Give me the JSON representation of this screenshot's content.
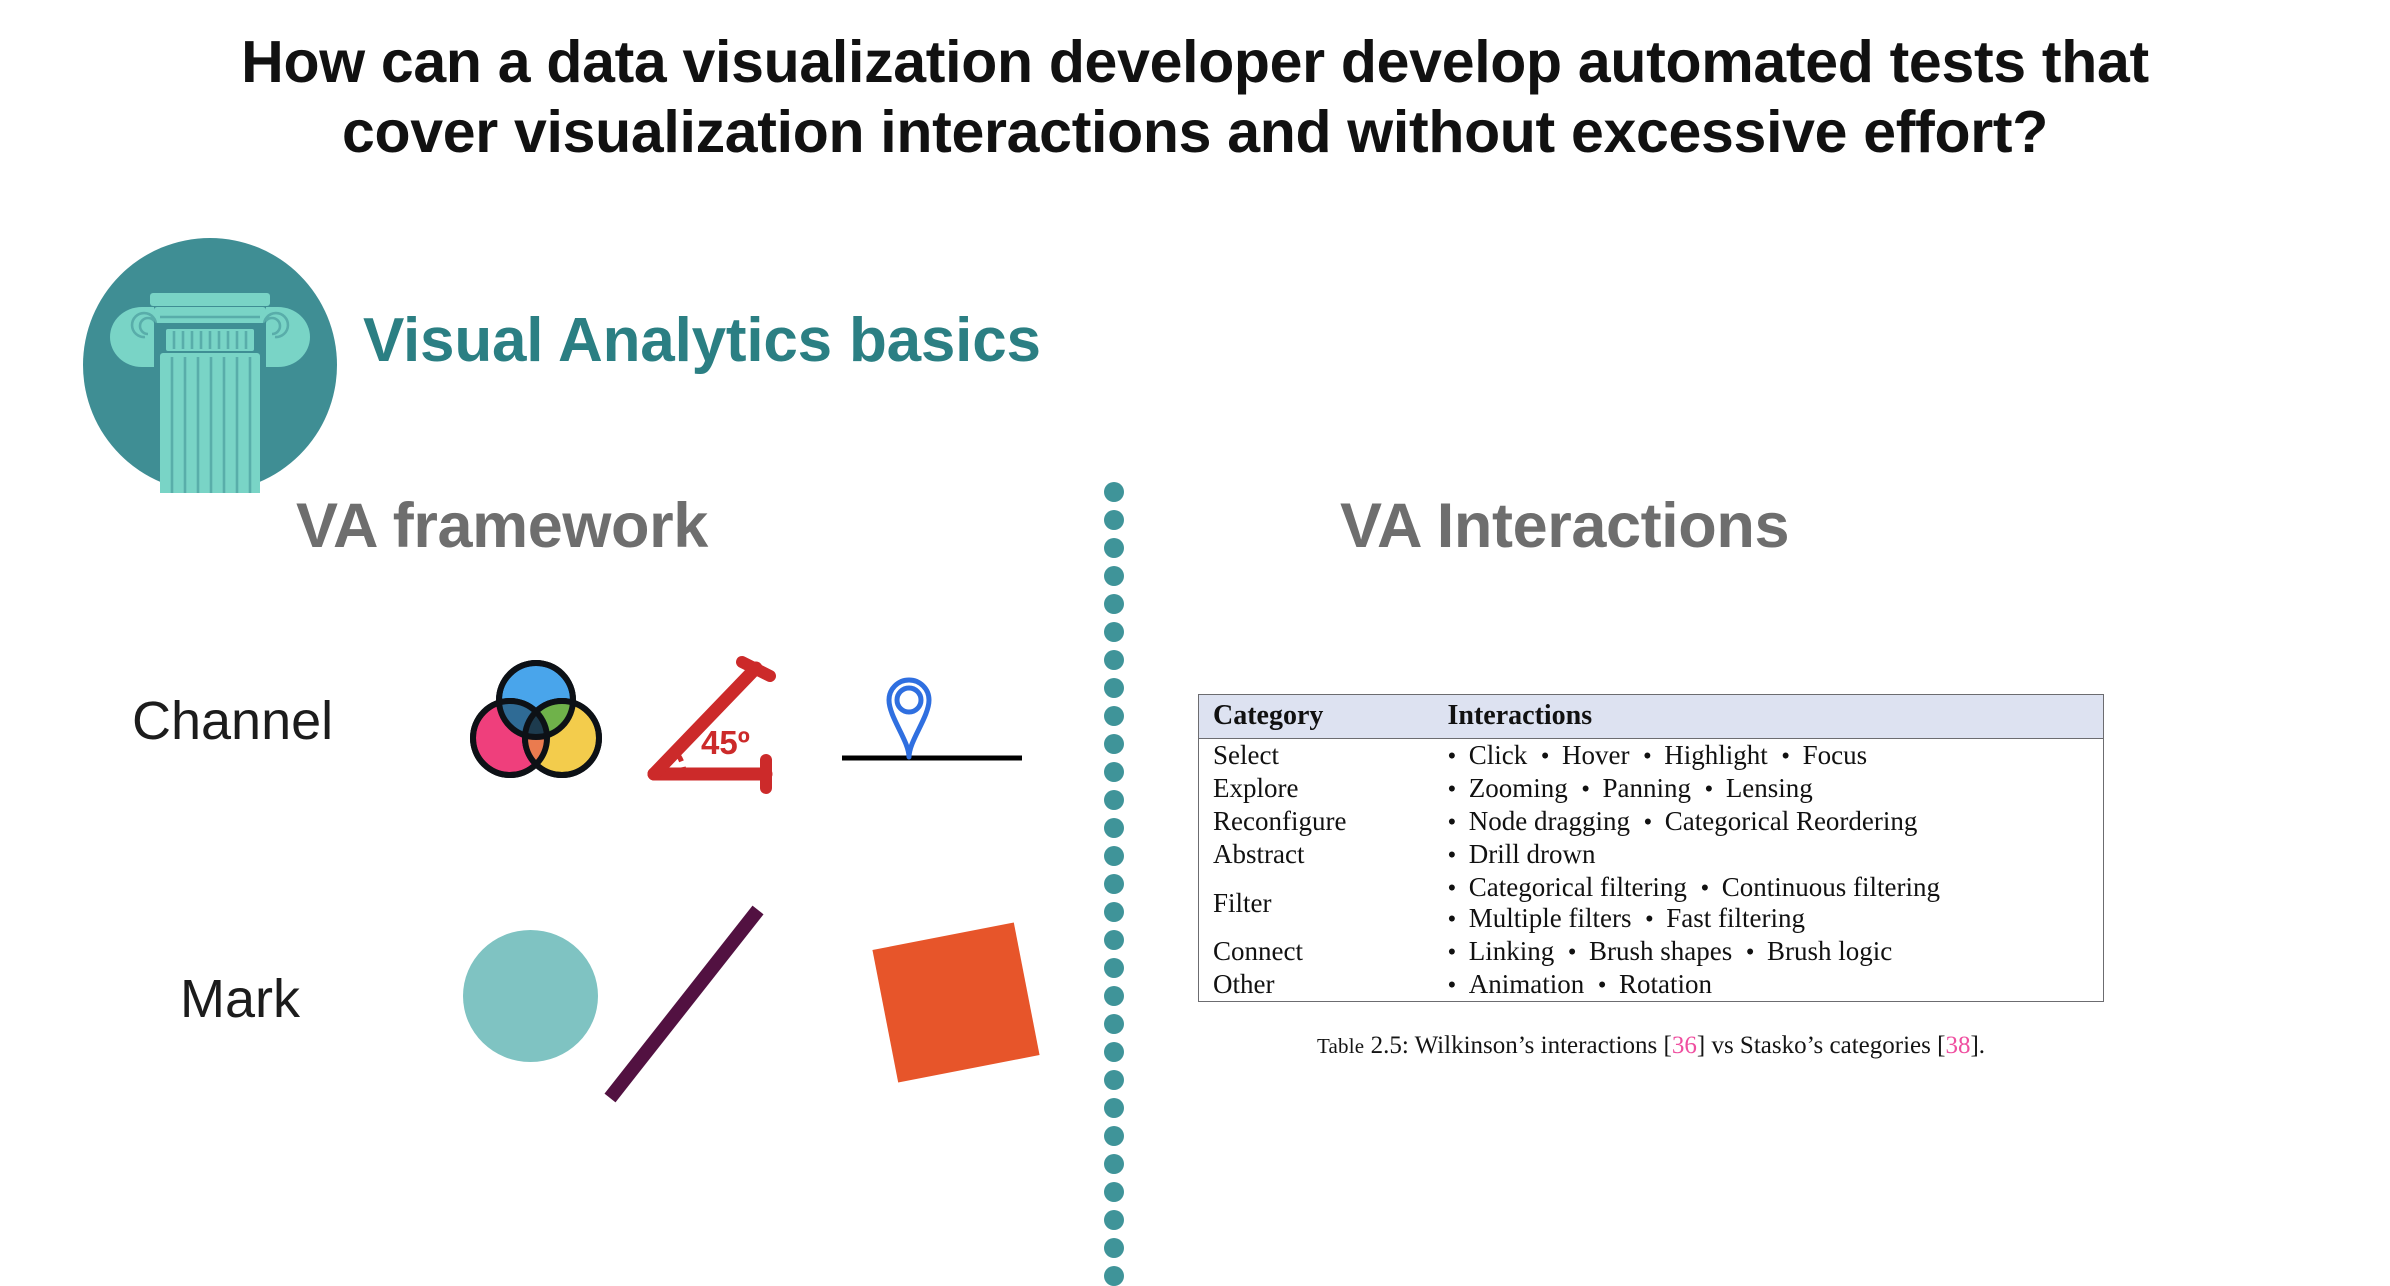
{
  "title": {
    "line1": "How can a data visualization developer develop automated tests that",
    "line2": "cover visualization interactions and without excessive effort?"
  },
  "section": {
    "heading": "Visual Analytics basics",
    "badge_icon": "pillar-icon",
    "badge_circle_color": "#3f8e94",
    "badge_column_color": "#79d4c6",
    "heading_color": "#2b7f83"
  },
  "columns": {
    "left_heading": "VA framework",
    "right_heading": "VA Interactions",
    "heading_color": "#6e6e6e",
    "divider_color": "#3f9499"
  },
  "framework": {
    "rows": [
      {
        "label": "Channel",
        "items": [
          {
            "icon": "venn-diagram-icon",
            "colors": [
              "#49a5eb",
              "#ef3f7c",
              "#f3cc4c"
            ]
          },
          {
            "icon": "angle-45-degrees-icon",
            "label": "45º",
            "color": "#cc2a2a"
          },
          {
            "icon": "map-pin-position-icon",
            "color": "#2f6fe0",
            "baseline_color": "#000000"
          }
        ]
      },
      {
        "label": "Mark",
        "items": [
          {
            "icon": "circle-mark-shape",
            "color": "#7fc3c2"
          },
          {
            "icon": "line-mark-shape",
            "color": "#521141"
          },
          {
            "icon": "square-mark-shape",
            "color": "#e7552a"
          }
        ]
      }
    ]
  },
  "table": {
    "header_bg": "#dde2f1",
    "columns": [
      "Category",
      "Interactions"
    ],
    "rows": [
      {
        "category": "Select",
        "lines": [
          [
            "Click",
            "Hover",
            "Highlight",
            "Focus"
          ]
        ]
      },
      {
        "category": "Explore",
        "lines": [
          [
            "Zooming",
            "Panning",
            "Lensing"
          ]
        ]
      },
      {
        "category": "Reconfigure",
        "lines": [
          [
            "Node dragging",
            "Categorical Reordering"
          ]
        ]
      },
      {
        "category": "Abstract",
        "lines": [
          [
            "Drill drown"
          ]
        ]
      },
      {
        "category": "Filter",
        "lines": [
          [
            "Categorical filtering",
            "Continuous filtering"
          ],
          [
            "Multiple filters",
            "Fast filtering"
          ]
        ]
      },
      {
        "category": "Connect",
        "lines": [
          [
            "Linking",
            "Brush shapes",
            "Brush logic"
          ]
        ]
      },
      {
        "category": "Other",
        "lines": [
          [
            "Animation",
            "Rotation"
          ]
        ]
      }
    ],
    "caption": {
      "label": "Table",
      "number": "2.5:",
      "text_before": "Wilkinson’s interactions",
      "cite1": "36",
      "text_middle": "vs Stasko’s categories",
      "cite2": "38",
      "text_after": ".",
      "cite_color": "#ef4fa0"
    }
  }
}
